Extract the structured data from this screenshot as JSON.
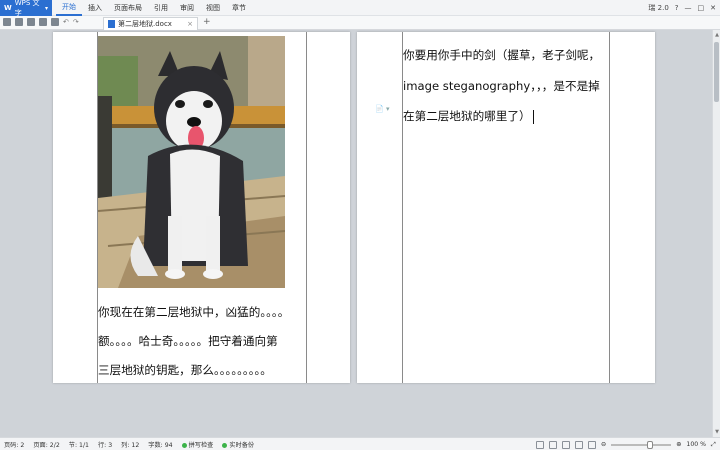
{
  "app": {
    "name": "WPS 文字",
    "dropdown_arrow": "▾"
  },
  "menu": [
    "开始",
    "插入",
    "页面布局",
    "引用",
    "审阅",
    "视图",
    "章节"
  ],
  "title_right": {
    "user": "瑞 2.0",
    "help": "?",
    "minimize": "—",
    "maximize": "□",
    "close": "✕"
  },
  "toolbar": {
    "undo": "↶",
    "redo": "↷"
  },
  "tab": {
    "filename": "第二层地狱.docx",
    "close": "×",
    "new_tab": "+"
  },
  "page1": {
    "lines": [
      "你现在在第二层地狱中，凶猛的。。。。",
      "额。。。。哈士奇。。。。。把守着通向第",
      "三层地狱的钥匙，那么。。。。。。。。。"
    ]
  },
  "page2": {
    "lines": [
      "你要用你手中的剑（握草，老子剑呢，",
      "image steganography，，，是不是掉",
      "在第二层地狱的哪里了）"
    ],
    "margin_note": "📄 ▾"
  },
  "status": {
    "page_num": "页码: 2",
    "pages": "页面: 2/2",
    "section": "节: 1/1",
    "row": "行: 3",
    "col": "列: 12",
    "words": "字数: 94",
    "spell": "拼写检查",
    "backup": "实时备份",
    "zoom": "100 %",
    "zoom_level_percent": 100
  },
  "colors": {
    "accent": "#2b6fd1",
    "status_ok": "#3cb34a"
  },
  "icons": [
    "open-icon",
    "save-icon",
    "print-icon",
    "undo-icon",
    "redo-icon",
    "doc-icon",
    "zoom-slider"
  ]
}
